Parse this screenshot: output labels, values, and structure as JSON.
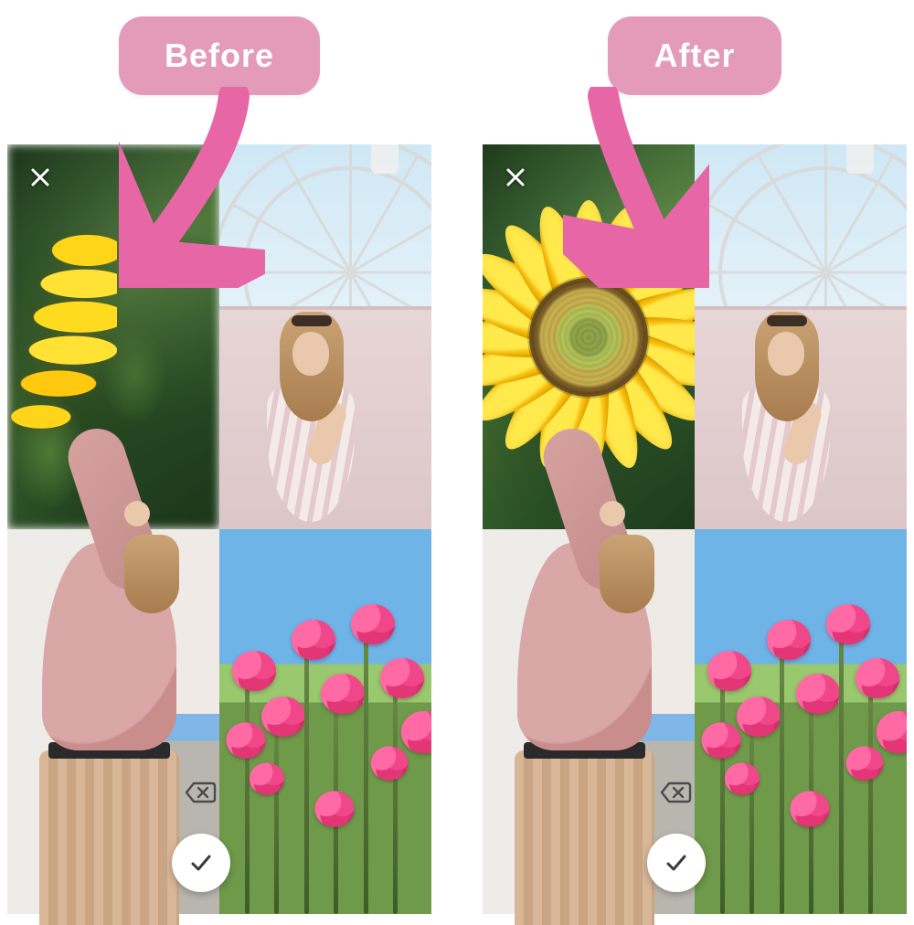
{
  "labels": {
    "before": "Before",
    "after": "After"
  },
  "icons": {
    "close": "×",
    "delete_backspace": "backspace-x",
    "confirm": "check"
  },
  "colors": {
    "pill_bg": "#e49ab9",
    "pill_text": "#ffffff",
    "arrow": "#e766a6"
  },
  "panels": {
    "before": {
      "grid": {
        "top_left": {
          "subject": "sunflower-cropped-offcenter",
          "focused": false
        },
        "top_right": {
          "subject": "woman-ferris-wheel"
        },
        "bottom_left": {
          "subject": "woman-pink-sweater"
        },
        "bottom_right": {
          "subject": "pink-ranunculus-field"
        }
      }
    },
    "after": {
      "grid": {
        "top_left": {
          "subject": "sunflower-centered",
          "focused": true
        },
        "top_right": {
          "subject": "woman-ferris-wheel"
        },
        "bottom_left": {
          "subject": "woman-pink-sweater"
        },
        "bottom_right": {
          "subject": "pink-ranunculus-field"
        }
      }
    }
  }
}
